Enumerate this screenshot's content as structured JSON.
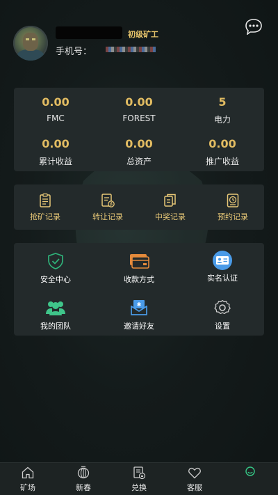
{
  "profile": {
    "level": "初级矿工",
    "phone_label": "手机号："
  },
  "stats": [
    {
      "value": "0.00",
      "label": "FMC"
    },
    {
      "value": "0.00",
      "label": "FOREST"
    },
    {
      "value": "5",
      "label": "电力"
    },
    {
      "value": "0.00",
      "label": "累计收益"
    },
    {
      "value": "0.00",
      "label": "总资产"
    },
    {
      "value": "0.00",
      "label": "推广收益"
    }
  ],
  "records": [
    {
      "label": "抢矿记录",
      "icon": "clipboard-icon"
    },
    {
      "label": "转让记录",
      "icon": "transfer-doc-icon"
    },
    {
      "label": "中奖记录",
      "icon": "copy-doc-icon"
    },
    {
      "label": "预约记录",
      "icon": "clock-doc-icon"
    }
  ],
  "menu": [
    {
      "label": "安全中心",
      "icon": "shield-icon"
    },
    {
      "label": "收款方式",
      "icon": "card-icon"
    },
    {
      "label": "实名认证",
      "icon": "id-card-icon"
    },
    {
      "label": "我的团队",
      "icon": "team-icon"
    },
    {
      "label": "邀请好友",
      "icon": "invite-envelope-icon"
    },
    {
      "label": "设置",
      "icon": "gear-icon"
    }
  ],
  "tabs": [
    {
      "label": "矿场",
      "icon": "home-icon"
    },
    {
      "label": "新春",
      "icon": "lantern-icon"
    },
    {
      "label": "兑换",
      "icon": "exchange-doc-icon"
    },
    {
      "label": "客服",
      "icon": "heart-icon"
    },
    {
      "label": "",
      "icon": "smile-icon",
      "active": true
    }
  ],
  "colors": {
    "accent_gold": "#e2bc62",
    "active_green": "#35c987",
    "card_bg": "#232a2b"
  }
}
